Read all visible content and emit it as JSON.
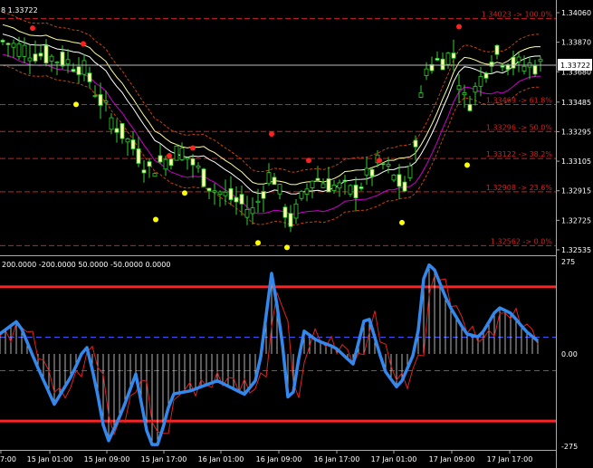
{
  "colors": {
    "background": "#000000",
    "bull_candle": "#ffffaa",
    "bear_candle": "#000000",
    "wick": "#33cc33",
    "fibo": "#cc2222",
    "band_upper": "#ffff99",
    "band_outer": "#cc4400",
    "band_lower": "#cc00cc",
    "fractal_up": "#ff2020",
    "fractal_down": "#ffff00",
    "cci": "#3388ee",
    "signal": "#dd2222",
    "histogram": "#e0e0e0",
    "level_line": "#ff2222",
    "ref_line": "#3355ff"
  },
  "header": {
    "symbol_partial": "8",
    "current_value": "1.33722"
  },
  "price_axis": {
    "ticks": [
      "1.34060",
      "1.33870",
      "1.33680",
      "1.33485",
      "1.33295",
      "1.33105",
      "1.32915",
      "1.32725",
      "1.32535"
    ],
    "current_price_label": "1.33722"
  },
  "fibo_levels": [
    {
      "label": "1.34023 -> 100.0%",
      "price": 1.34023
    },
    {
      "label": "1.33469 -> 61.8%",
      "price": 1.33469
    },
    {
      "label": "1.33296 -> 50.0%",
      "price": 1.33296
    },
    {
      "label": "1.33122 -> 38.2%",
      "price": 1.33122
    },
    {
      "label": "1.32908 -> 23.6%",
      "price": 1.32908
    },
    {
      "label": "1.32562 -> 0.0%",
      "price": 1.32562
    }
  ],
  "indicator": {
    "title": "200.0000 -200.0000 50.0000 -50.0000 0.0000",
    "ticks": [
      "275",
      "0.00",
      "-275"
    ],
    "levels": [
      200,
      -200,
      50,
      -50,
      0
    ]
  },
  "time_axis": [
    "7:00",
    "15 Jan 01:00",
    "15 Jan 09:00",
    "15 Jan 17:00",
    "16 Jan 01:00",
    "16 Jan 09:00",
    "16 Jan 17:00",
    "17 Jan 01:00",
    "17 Jan 09:00",
    "17 Jan 17:00"
  ]
}
